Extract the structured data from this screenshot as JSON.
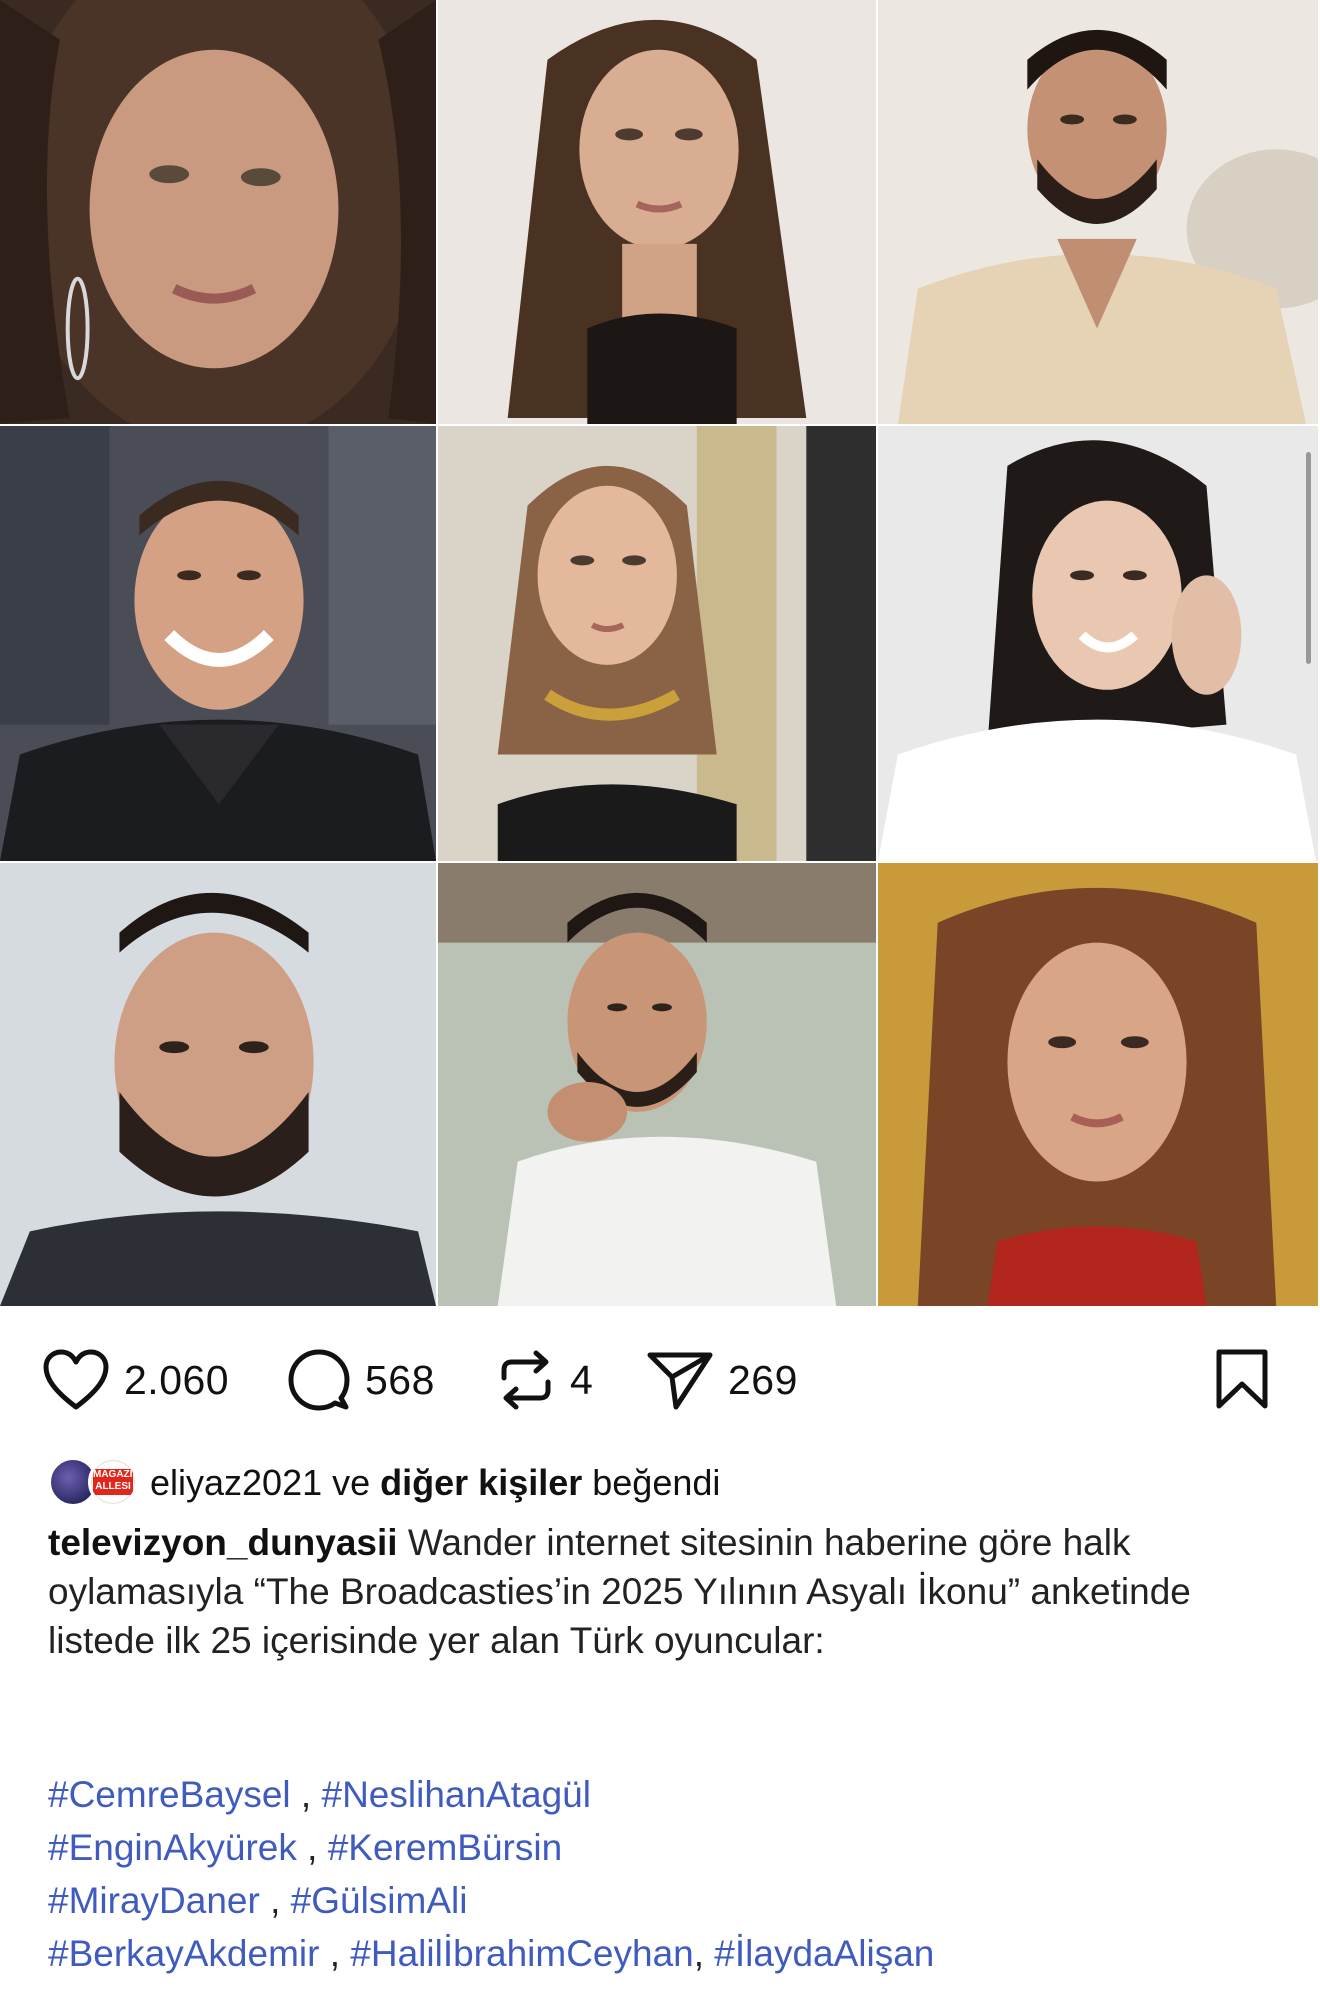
{
  "photos": [
    {
      "name": "photo-woman-curly-hair"
    },
    {
      "name": "photo-woman-long-brown-hair"
    },
    {
      "name": "photo-man-beige-shirt"
    },
    {
      "name": "photo-man-smiling-black-jacket"
    },
    {
      "name": "photo-woman-gold-necklace"
    },
    {
      "name": "photo-woman-hand-on-face"
    },
    {
      "name": "photo-man-beard-dark-suit"
    },
    {
      "name": "photo-man-white-shirt-hand-chin"
    },
    {
      "name": "photo-woman-red-top"
    }
  ],
  "actions": {
    "likes": "2.060",
    "comments": "568",
    "reposts": "4",
    "shares": "269"
  },
  "liked_by": {
    "user": "eliyaz2021",
    "connector": " ve ",
    "others": "diğer kişiler",
    "suffix": " beğendi",
    "avatar2_text": "MAGAZIN ALLESI"
  },
  "caption": {
    "username": "televizyon_dunyasii",
    "text": " Wander internet sitesinin haberine göre halk oylamasıyla “The Broadcasties’in 2025 Yılının Asyalı İkonu” anketinde listede ilk 25 içerisinde yer alan Türk oyuncular:"
  },
  "hashtags": {
    "line1": [
      "#CemreBaysel",
      "#NeslihanAtagül"
    ],
    "line2": [
      "#EnginAkyürek",
      "#KeremBürsin"
    ],
    "line3": [
      "#MirayDaner",
      "#GülsimAli"
    ],
    "line4": [
      "#BerkayAkdemir",
      "#HalilİbrahimCeyhan",
      "#İlaydaAlişan"
    ],
    "separator": " , ",
    "separator_tight": ", "
  },
  "colors": {
    "hashtag": "#3f5bbf",
    "text": "#222222"
  }
}
